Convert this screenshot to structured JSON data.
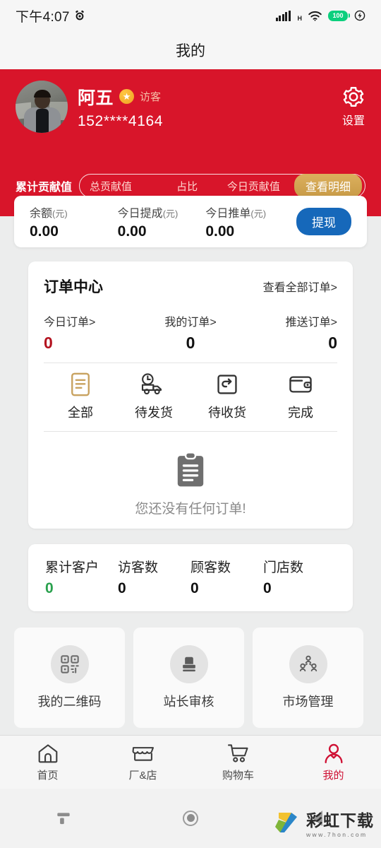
{
  "statusbar": {
    "time": "下午4:07",
    "alarm_icon": "alarm-icon",
    "signal_icon": "signal-bars-icon",
    "network_type": "H",
    "wifi_icon": "wifi-icon",
    "battery_level": "100",
    "extra_icon": "data-saver-icon"
  },
  "titlebar": {
    "title": "我的"
  },
  "header": {
    "background_color": "#d8152a",
    "avatar_name": "user-avatar",
    "user_name": "阿五",
    "badge_icon": "star-badge-icon",
    "user_tag": "访客",
    "phone": "152****4164",
    "settings_icon": "gear-icon",
    "settings_label": "设置",
    "contribution": {
      "label": "累计贡献值",
      "cells": [
        "总贡献值",
        "占比",
        "今日贡献值"
      ],
      "button": "查看明细",
      "button_color": "#c79a46"
    }
  },
  "balance": {
    "items": [
      {
        "label": "余额",
        "unit": "(元)",
        "value": "0.00"
      },
      {
        "label": "今日提成",
        "unit": "(元)",
        "value": "0.00"
      },
      {
        "label": "今日推单",
        "unit": "(元)",
        "value": "0.00"
      }
    ],
    "withdraw_label": "提现",
    "withdraw_color": "#1668ba"
  },
  "orders": {
    "title": "订单中心",
    "view_all": "查看全部订单>",
    "stats": [
      {
        "label": "今日订单>",
        "value": "0",
        "color": "#b3121f"
      },
      {
        "label": "我的订单>",
        "value": "0",
        "color": "#111111"
      },
      {
        "label": "推送订单>",
        "value": "0",
        "color": "#111111"
      }
    ],
    "status_icons": [
      {
        "label": "全部",
        "icon": "document-lines-icon",
        "color": "#c8a25f"
      },
      {
        "label": "待发货",
        "icon": "truck-clock-icon",
        "color": "#333333"
      },
      {
        "label": "待收货",
        "icon": "return-box-icon",
        "color": "#333333"
      },
      {
        "label": "完成",
        "icon": "wallet-icon",
        "color": "#333333"
      }
    ],
    "empty_icon": "clipboard-icon",
    "empty_text": "您还没有任何订单!"
  },
  "customers": [
    {
      "label": "累计客户",
      "value": "0",
      "color": "#2aa14e"
    },
    {
      "label": "访客数",
      "value": "0",
      "color": "#111111"
    },
    {
      "label": "顾客数",
      "value": "0",
      "color": "#111111"
    },
    {
      "label": "门店数",
      "value": "0",
      "color": "#111111"
    }
  ],
  "tiles": [
    {
      "label": "我的二维码",
      "icon": "qr-code-icon"
    },
    {
      "label": "站长审核",
      "icon": "stamp-icon"
    },
    {
      "label": "市场管理",
      "icon": "people-network-icon"
    }
  ],
  "tabbar": [
    {
      "label": "首页",
      "icon": "home-icon",
      "active": false
    },
    {
      "label": "厂&店",
      "icon": "store-icon",
      "active": false
    },
    {
      "label": "购物车",
      "icon": "cart-icon",
      "active": false
    },
    {
      "label": "我的",
      "icon": "person-icon",
      "active": true
    }
  ],
  "sysnav": {
    "recents_icon": "recents-icon",
    "home_icon": "home-circle-icon",
    "back_icon": "back-triangle-icon"
  },
  "watermark": {
    "title": "彩虹下载",
    "url": "www.7hon.com"
  }
}
